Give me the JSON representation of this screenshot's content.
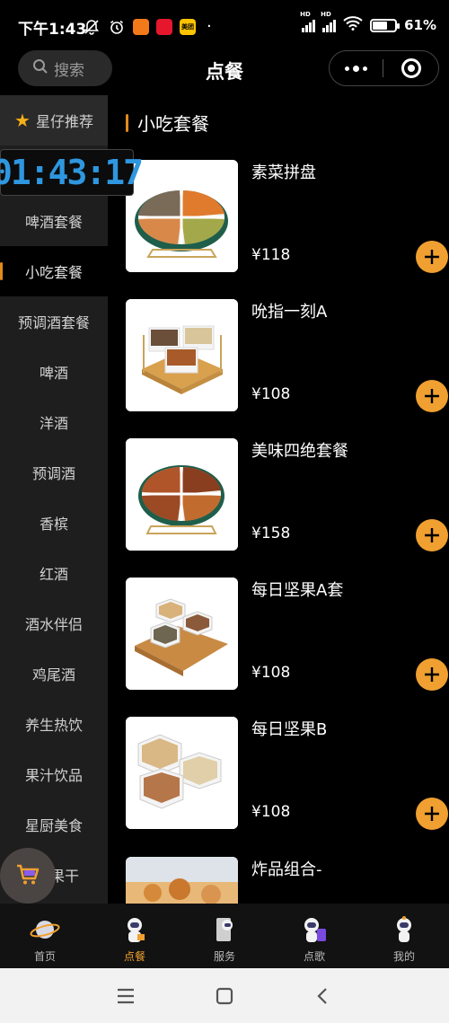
{
  "status_bar": {
    "time": "下午1:43",
    "battery_percent": "61%",
    "battery_level": 0.61,
    "app_icons": [
      {
        "name": "notification-app-icon-1",
        "label": "",
        "color": "#f27a1a"
      },
      {
        "name": "weibo-icon",
        "label": "",
        "color": "#e6162d"
      },
      {
        "name": "meituan-icon",
        "label": "美团",
        "color": "#ffc300"
      }
    ]
  },
  "nav": {
    "search_placeholder": "搜索",
    "title": "点餐"
  },
  "timer": "01:43:17",
  "sidebar": {
    "items": [
      {
        "label": "星仔推荐",
        "state": "top"
      },
      {
        "label": "",
        "state": "hidden"
      },
      {
        "label": "啤酒套餐",
        "state": "prev"
      },
      {
        "label": "小吃套餐",
        "state": "active"
      },
      {
        "label": "预调酒套餐",
        "state": "next"
      },
      {
        "label": "啤酒",
        "state": ""
      },
      {
        "label": "洋酒",
        "state": ""
      },
      {
        "label": "预调酒",
        "state": ""
      },
      {
        "label": "香槟",
        "state": ""
      },
      {
        "label": "红酒",
        "state": ""
      },
      {
        "label": "酒水伴侣",
        "state": ""
      },
      {
        "label": "鸡尾酒",
        "state": ""
      },
      {
        "label": "养生热饮",
        "state": ""
      },
      {
        "label": "果汁饮品",
        "state": ""
      },
      {
        "label": "星厨美食",
        "state": ""
      },
      {
        "label": "果干",
        "state": ""
      }
    ]
  },
  "section": {
    "title": "小吃套餐"
  },
  "products": [
    {
      "name": "素菜拼盘",
      "price": "¥118"
    },
    {
      "name": "吮指一刻A",
      "price": "¥108"
    },
    {
      "name": "美味四绝套餐",
      "price": "¥158"
    },
    {
      "name": "每日坚果A套",
      "price": "¥108"
    },
    {
      "name": "每日坚果B",
      "price": "¥108"
    },
    {
      "name": "炸品组合-",
      "price": ""
    }
  ],
  "tabbar": {
    "tabs": [
      {
        "label": "首页",
        "icon": "planet-icon",
        "active": false
      },
      {
        "label": "点餐",
        "icon": "astronaut-order-icon",
        "active": true
      },
      {
        "label": "服务",
        "icon": "astronaut-service-icon",
        "active": false
      },
      {
        "label": "点歌",
        "icon": "astronaut-music-icon",
        "active": false
      },
      {
        "label": "我的",
        "icon": "astronaut-profile-icon",
        "active": false
      }
    ]
  },
  "colors": {
    "accent": "#f0a030",
    "timer": "#2e97e0",
    "star": "#f5b018"
  }
}
